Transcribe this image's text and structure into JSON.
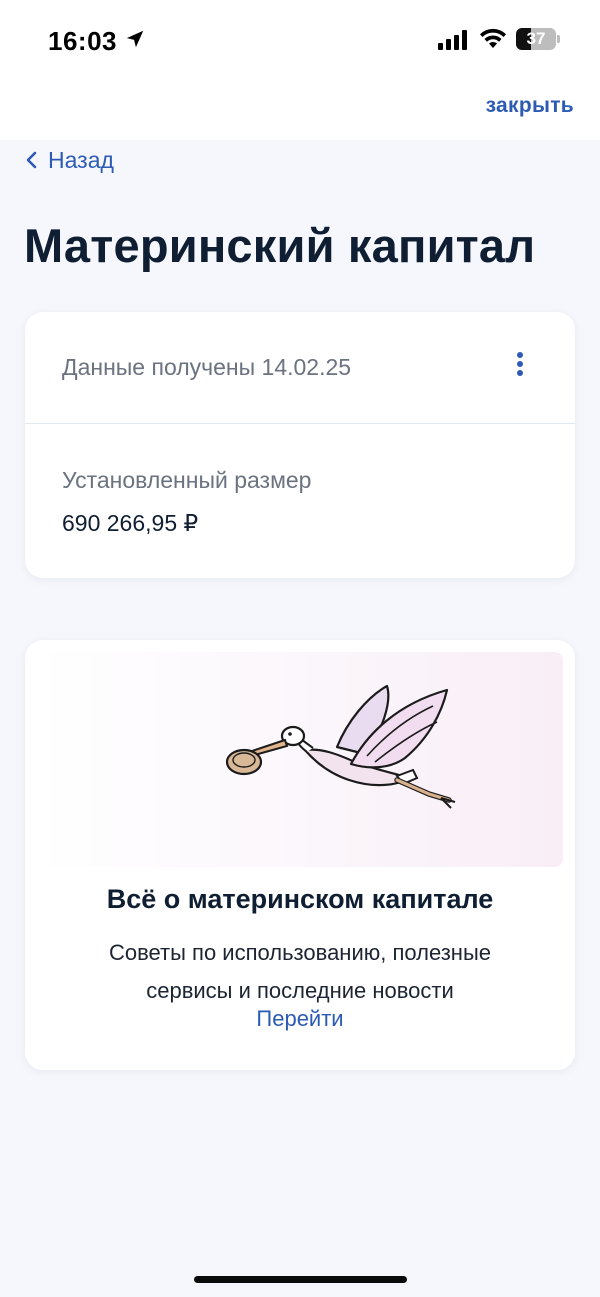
{
  "status_bar": {
    "time": "16:03",
    "battery": "37",
    "battery_level": 0.37
  },
  "header": {
    "close_label": "закрыть",
    "back_label": "Назад"
  },
  "page": {
    "title": "Материнский капитал"
  },
  "info_card": {
    "data_received": "Данные получены 14.02.25",
    "amount_label": "Установленный размер",
    "amount_value": "690 266,95 ₽"
  },
  "promo_card": {
    "title": "Всё о материнском капитале",
    "text": "Советы по использованию, полезные сервисы и последние новости",
    "link_label": "Перейти"
  },
  "colors": {
    "accent": "#2d5bb3",
    "title": "#0f1e32",
    "muted": "#6b7280",
    "background": "#f5f7fc"
  }
}
